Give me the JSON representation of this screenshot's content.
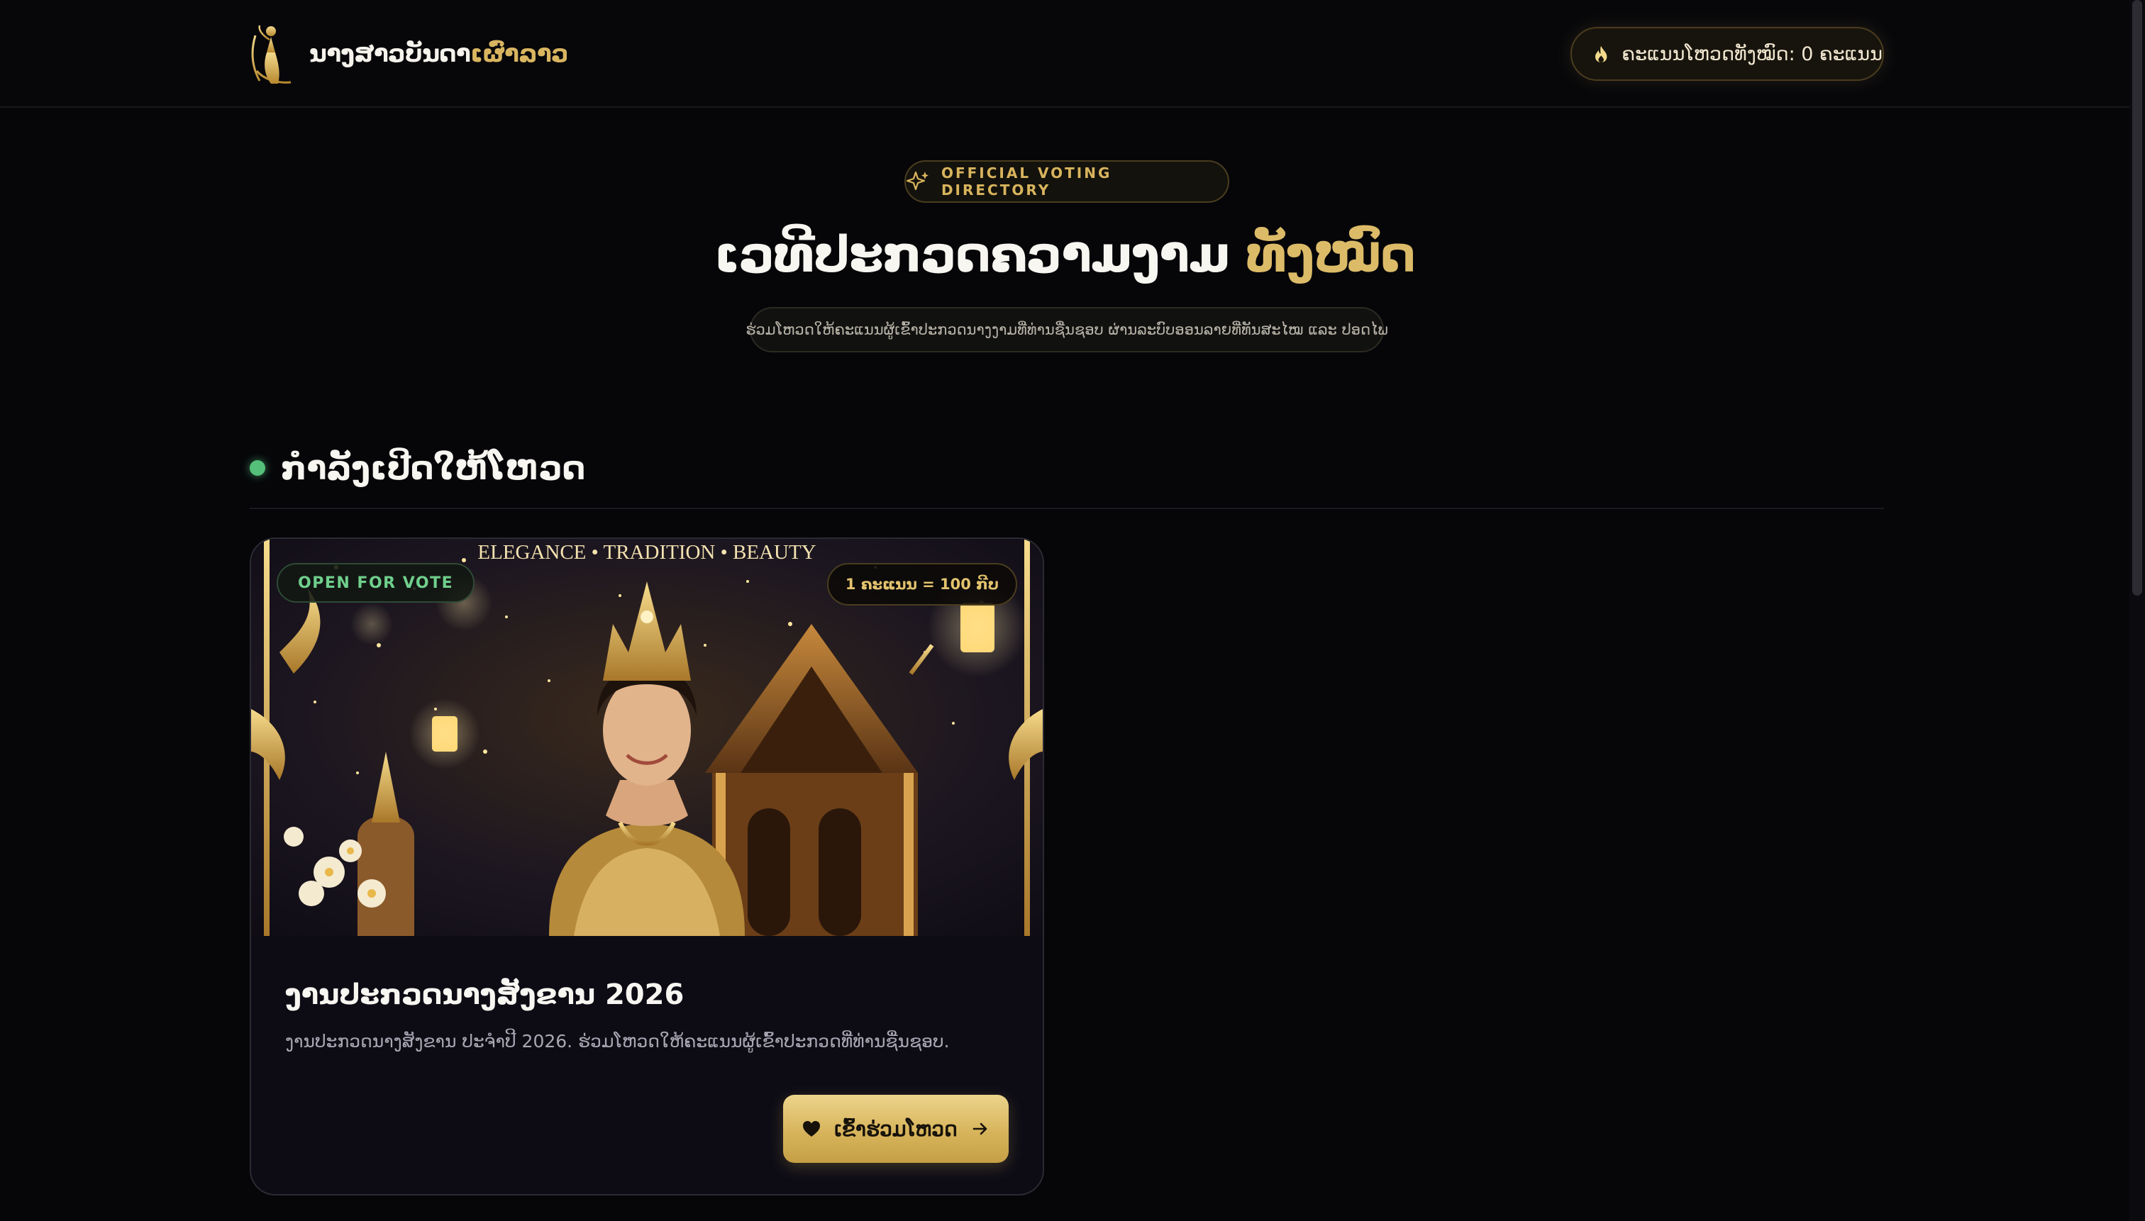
{
  "header": {
    "brand_main": "ນາງສາວບັນດາ",
    "brand_accent": "ເຜົ່າລາວ",
    "total_score": "ຄະແນນໂຫວດທັງໝົດ: 0 ຄະແນນ"
  },
  "hero": {
    "badge": "OFFICIAL VOTING DIRECTORY",
    "title_main": "ເວທີປະກວດຄວາມງາມ",
    "title_accent": "ທັງໝົດ",
    "subtitle": "ຮ່ວມໂຫວດໃຫ້ຄະແນນຜູ້ເຂົ້າປະກວດນາງງາມທີ່ທ່ານຊື່ນຊອບ ຜ່ານລະບົບອອນລາຍທີ່ທັນສະໄໝ ແລະ ປອດໄພ"
  },
  "section": {
    "title": "ກຳລັງເປີດໃຫ້ໂຫວດ"
  },
  "card": {
    "banner_caption": "ELEGANCE • TRADITION • BEAUTY",
    "status_badge": "OPEN FOR VOTE",
    "rate_badge": "1 ຄະແນນ = 100 ກີບ",
    "title": "ງານປະກວດນາງສັງຂານ 2026",
    "description": "ງານປະກວດນາງສັງຂານ ປະຈຳປີ 2026. ຮ່ວມໂຫວດໃຫ້ຄະແນນຜູ້ເຂົ້າປະກວດທີ່ທ່ານຊື່ນຊອບ.",
    "button_label": "ເຂົ້າຮ່ວມໂຫວດ"
  },
  "colors": {
    "background": "#060609",
    "gold": "#d9b560",
    "live_green": "#54c07a"
  }
}
